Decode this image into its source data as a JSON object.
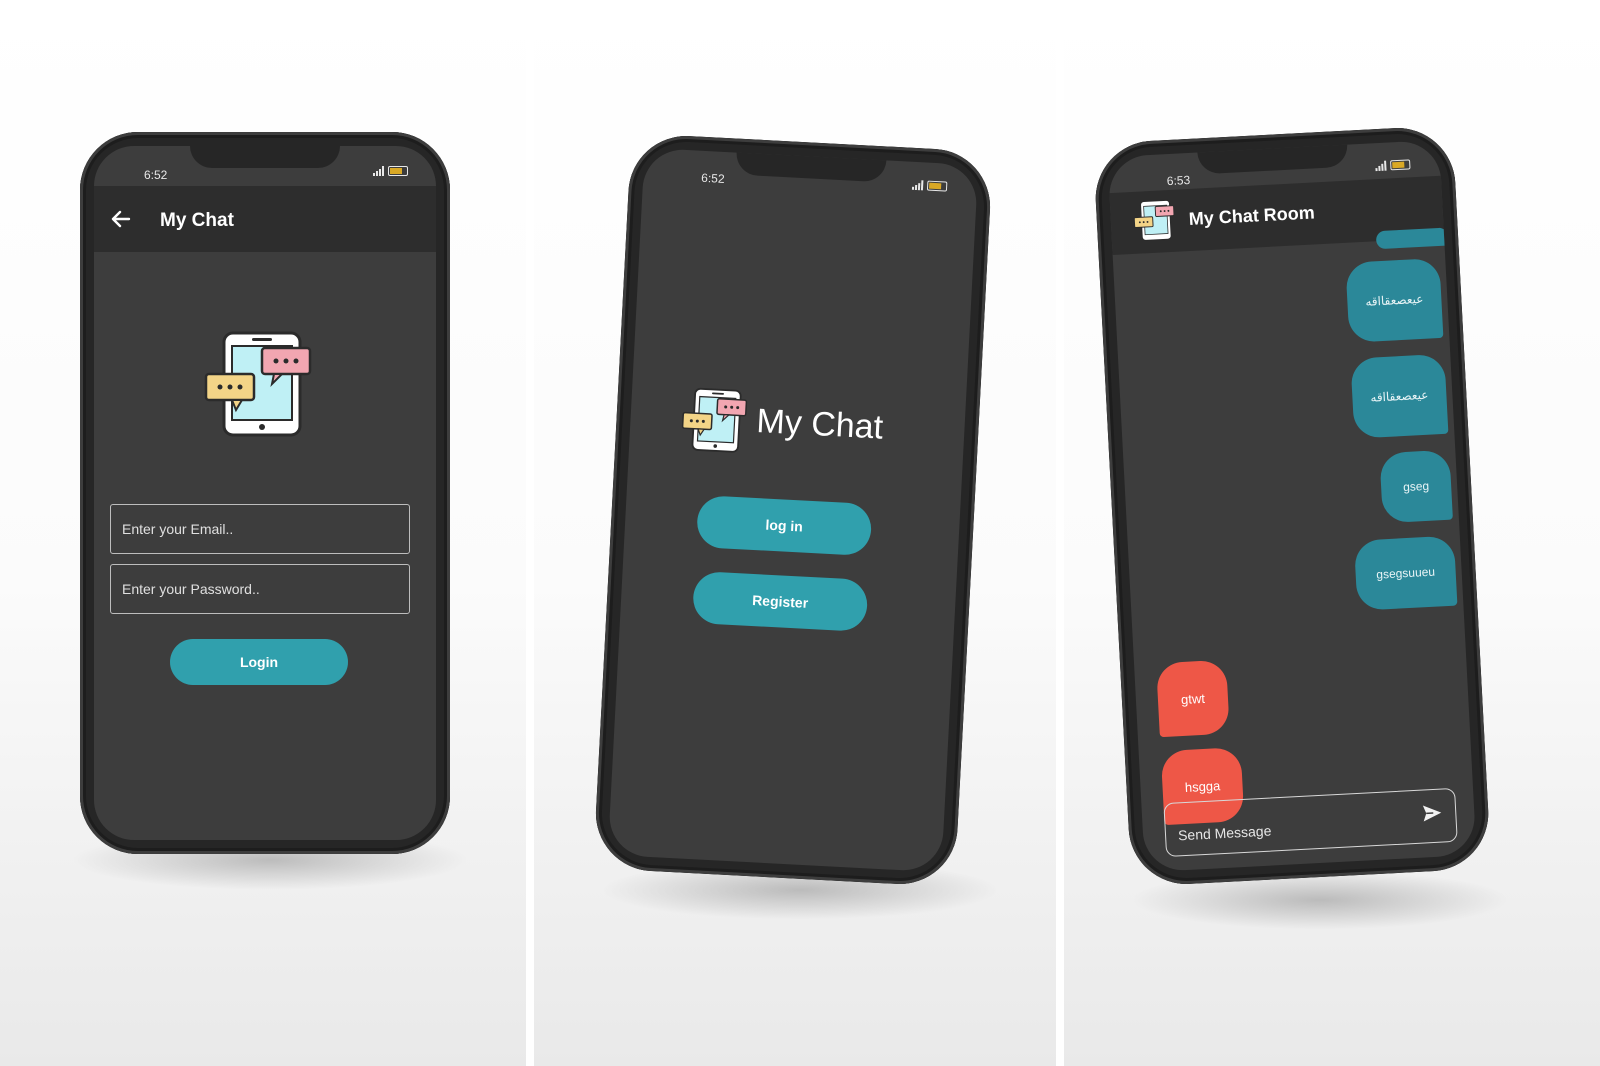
{
  "colors": {
    "phone_body": "#262626",
    "screen_bg": "#3d3d3d",
    "appbar_bg": "#2d2d2d",
    "accent_teal": "#30a0ad",
    "bubble_sent": "#2b8899",
    "bubble_received": "#ee5747",
    "logo_yellow": "#f3d487",
    "logo_pink": "#f2a6b1",
    "logo_cyan": "#bff0f5"
  },
  "phone_login": {
    "status_time": "6:52",
    "appbar": {
      "back_icon": "arrow-left-icon",
      "title": "My Chat"
    },
    "email_placeholder": "Enter your Email..",
    "password_placeholder": "Enter your Password..",
    "login_label": "Login"
  },
  "phone_welcome": {
    "status_time": "6:52",
    "app_title": "My Chat",
    "login_label": "log in",
    "register_label": "Register"
  },
  "phone_chat": {
    "status_time": "6:53",
    "room_title": "My Chat Room",
    "messages": [
      {
        "from": "me",
        "text": "عيعصعقااقه"
      },
      {
        "from": "me",
        "text": "عيعصعقااقه"
      },
      {
        "from": "me",
        "text": "gseg"
      },
      {
        "from": "me",
        "text": "gsegsuueu"
      },
      {
        "from": "them",
        "text": "gtwt"
      },
      {
        "from": "them",
        "text": "hsgga"
      }
    ],
    "message_placeholder": "Send Message",
    "send_icon": "send-icon"
  }
}
